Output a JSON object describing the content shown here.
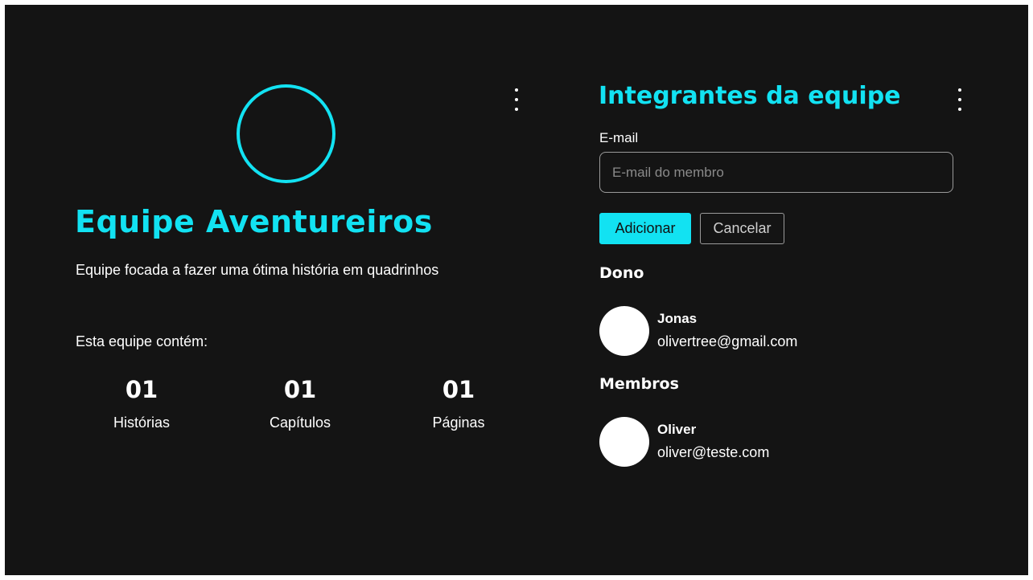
{
  "team": {
    "name": "Equipe Aventureiros",
    "description": "Equipe focada a fazer uma ótima história em quadrinhos",
    "contains_label": "Esta equipe contém:",
    "stats": [
      {
        "value": "01",
        "label": "Histórias"
      },
      {
        "value": "01",
        "label": "Capítulos"
      },
      {
        "value": "01",
        "label": "Páginas"
      }
    ]
  },
  "members_panel": {
    "title": "Integrantes da equipe",
    "email_label": "E-mail",
    "email_placeholder": "E-mail do membro",
    "email_value": "",
    "add_label": "Adicionar",
    "cancel_label": "Cancelar",
    "owner_heading": "Dono",
    "owner": {
      "name": "Jonas",
      "email": "olivertree@gmail.com"
    },
    "members_heading": "Membros",
    "members": [
      {
        "name": "Oliver",
        "email": "oliver@teste.com"
      }
    ]
  },
  "colors": {
    "accent": "#12e2f2",
    "background": "#141414",
    "text": "#ffffff"
  },
  "icons": {
    "team_menu": "more-vertical-icon",
    "members_menu": "more-vertical-icon"
  }
}
